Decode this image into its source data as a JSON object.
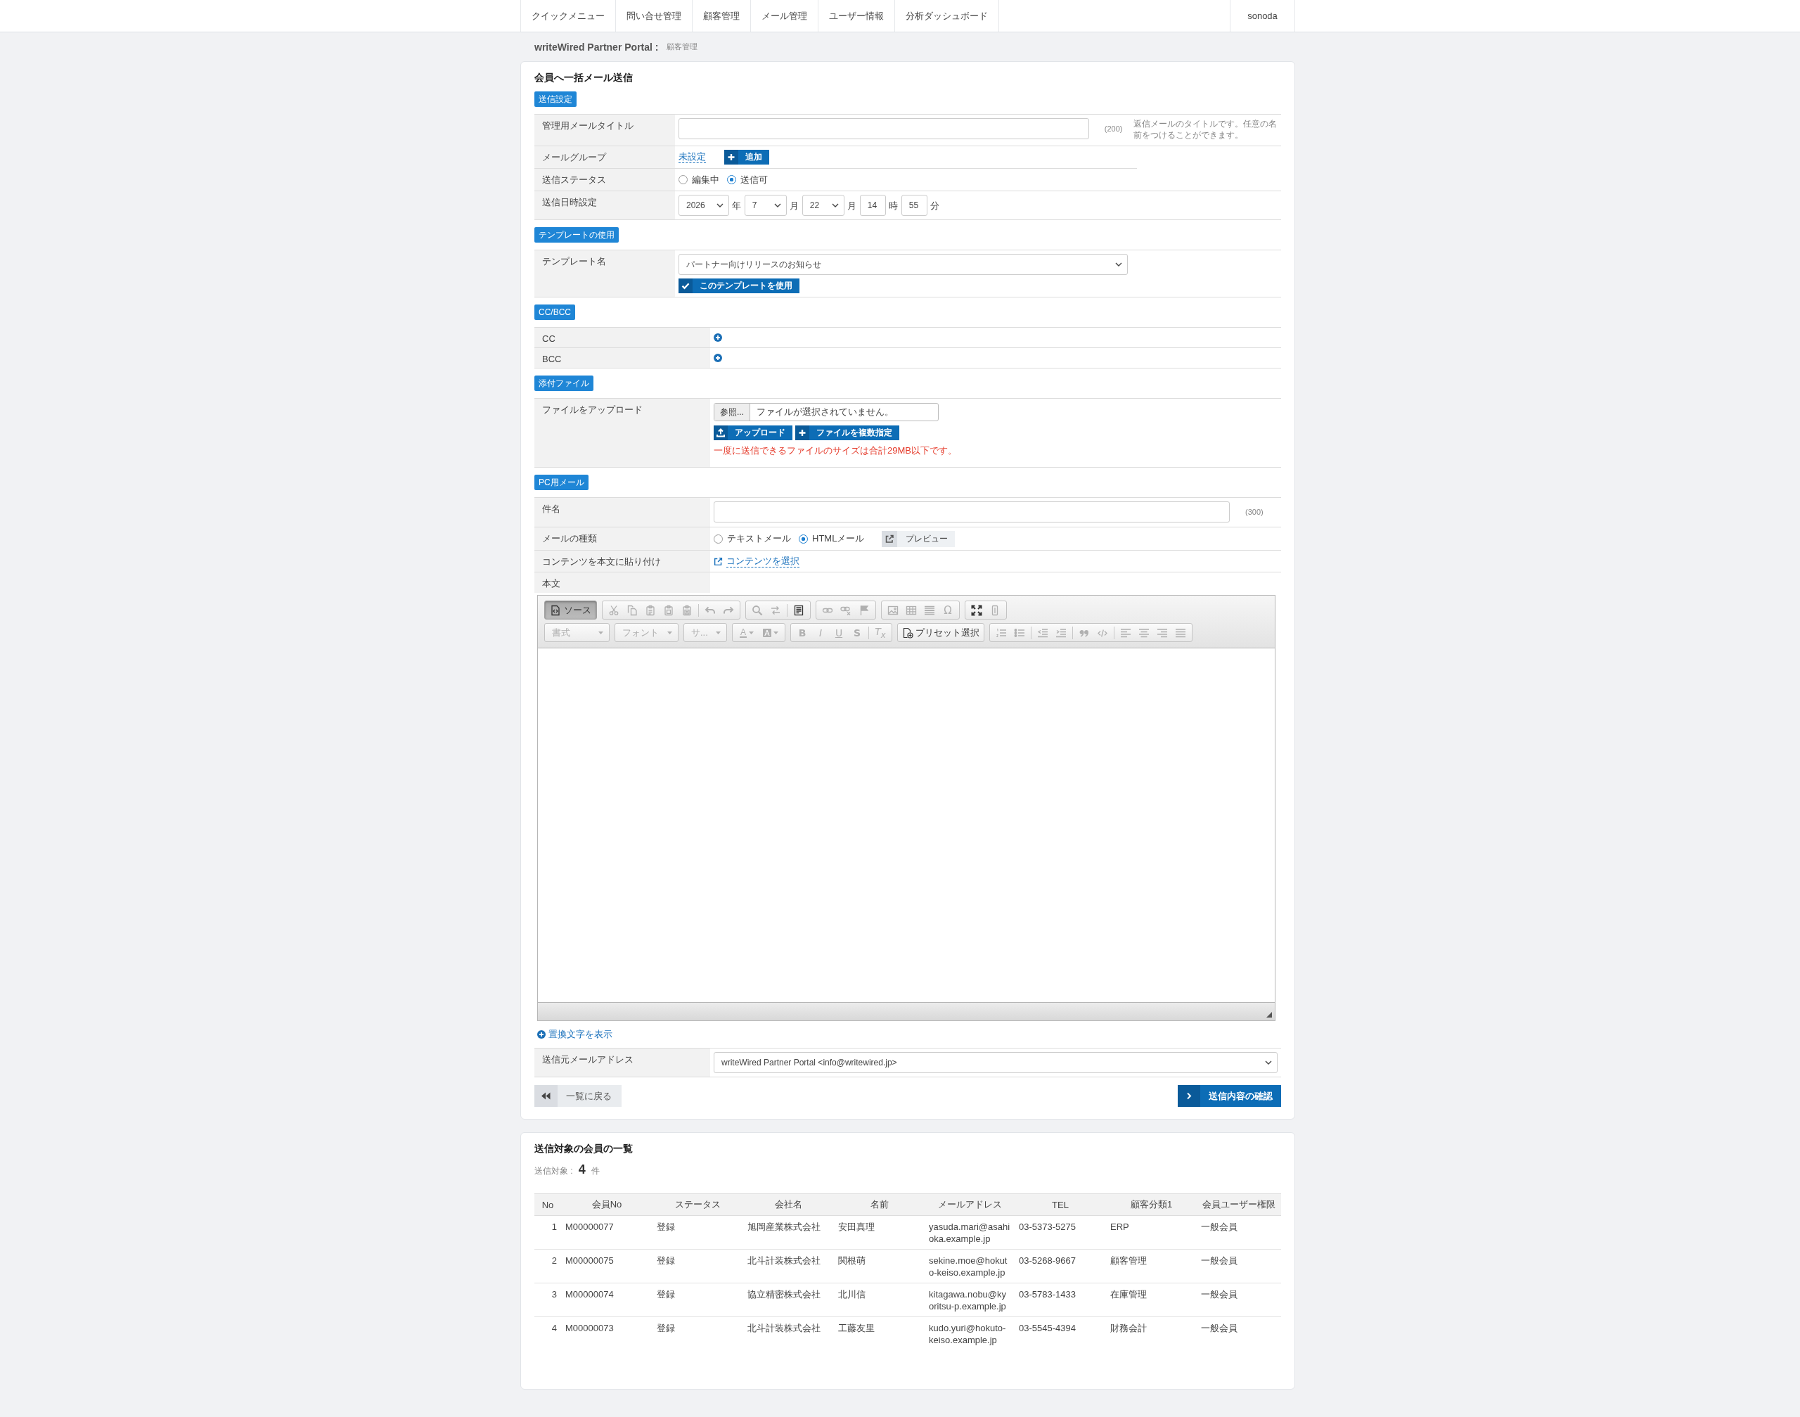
{
  "nav": {
    "items": [
      "クイックメニュー",
      "問い合せ管理",
      "顧客管理",
      "メール管理",
      "ユーザー情報",
      "分析ダッシュボード"
    ],
    "user": "sonoda"
  },
  "breadcrumb": {
    "site": "writeWired Partner Portal :",
    "page": "顧客管理"
  },
  "mail_form": {
    "title": "会員へ一括メール送信",
    "send_settings": {
      "badge": "送信設定",
      "admin_title": {
        "label": "管理用メールタイトル",
        "counter": "(200)",
        "help": "返信メールのタイトルです。任意の名前をつけることができます。"
      },
      "mail_group": {
        "label": "メールグループ",
        "value": "未設定",
        "button": "追加"
      },
      "status": {
        "label": "送信ステータス",
        "options": [
          {
            "label": "編集中",
            "selected": false
          },
          {
            "label": "送信可",
            "selected": true
          }
        ]
      },
      "schedule": {
        "label": "送信日時設定",
        "parts": [
          {
            "kind": "select",
            "value": "2026"
          },
          {
            "kind": "unit",
            "text": "年"
          },
          {
            "kind": "select",
            "value": "7"
          },
          {
            "kind": "unit",
            "text": "月"
          },
          {
            "kind": "select",
            "value": "22"
          },
          {
            "kind": "unit",
            "text": "月"
          },
          {
            "kind": "input",
            "value": "14"
          },
          {
            "kind": "unit",
            "text": "時"
          },
          {
            "kind": "input",
            "value": "55"
          },
          {
            "kind": "unit",
            "text": "分"
          }
        ]
      }
    },
    "template": {
      "badge": "テンプレートの使用",
      "label": "テンプレート名",
      "value": "パートナー向けリリースのお知らせ",
      "button": "このテンプレートを使用"
    },
    "cc_bcc": {
      "badge": "CC/BCC",
      "rows": [
        "CC",
        "BCC"
      ]
    },
    "attachments": {
      "badge": "添付ファイル",
      "label": "ファイルをアップロード",
      "browse_button": "参照...",
      "file_status": "ファイルが選択されていません。",
      "upload_button": "アップロード",
      "multi_button": "ファイルを複数指定",
      "note": "一度に送信できるファイルのサイズは合計29MB以下です。"
    },
    "pc_mail": {
      "badge": "PC用メール",
      "subject": {
        "label": "件名",
        "counter": "(300)"
      },
      "mail_type": {
        "label": "メールの種類",
        "options": [
          {
            "label": "テキストメール",
            "selected": false
          },
          {
            "label": "HTMLメール",
            "selected": true
          }
        ],
        "preview_button": "プレビュー"
      },
      "paste_contents": {
        "label": "コンテンツを本文に貼り付け",
        "link": "コンテンツを選択"
      },
      "body_label": "本文"
    },
    "editor": {
      "toolbar": [
        [
          [
            {
              "kind": "source",
              "label": "ソース",
              "on": true
            }
          ],
          [
            {
              "kind": "cut",
              "disabled": true
            },
            {
              "kind": "copy",
              "disabled": true
            },
            {
              "kind": "paste",
              "disabled": true
            },
            {
              "kind": "paste-text",
              "disabled": true
            },
            {
              "kind": "paste-word",
              "disabled": true
            },
            {
              "kind": "separator"
            },
            {
              "kind": "undo",
              "disabled": true
            },
            {
              "kind": "redo",
              "disabled": true
            }
          ],
          [
            {
              "kind": "find",
              "disabled": true
            },
            {
              "kind": "replace",
              "disabled": true
            },
            {
              "kind": "separator"
            },
            {
              "kind": "template",
              "disabled": false
            }
          ],
          [
            {
              "kind": "link",
              "disabled": true
            },
            {
              "kind": "unlink",
              "disabled": true
            },
            {
              "kind": "anchor",
              "disabled": true
            }
          ],
          [
            {
              "kind": "image",
              "disabled": true
            },
            {
              "kind": "table",
              "disabled": true
            },
            {
              "kind": "rule",
              "disabled": true
            },
            {
              "kind": "symbol",
              "label": "Ω",
              "disabled": true
            }
          ],
          [
            {
              "kind": "maximize",
              "disabled": false
            },
            {
              "kind": "blocks",
              "disabled": true
            }
          ]
        ],
        [
          [
            {
              "kind": "combo",
              "label": "書式",
              "disabled": true
            }
          ],
          [
            {
              "kind": "combo",
              "label": "フォント",
              "disabled": true
            }
          ],
          [
            {
              "kind": "combo",
              "label": "サ...",
              "disabled": true
            }
          ],
          [
            {
              "kind": "text-color",
              "label": "A",
              "disabled": true
            },
            {
              "kind": "bg-color",
              "label": "A",
              "disabled": true
            }
          ],
          [
            {
              "kind": "bold",
              "label": "B",
              "disabled": true
            },
            {
              "kind": "italic",
              "label": "I",
              "disabled": true
            },
            {
              "kind": "underline",
              "label": "U",
              "disabled": true
            },
            {
              "kind": "strike",
              "label": "S",
              "disabled": true
            },
            {
              "kind": "separator"
            },
            {
              "kind": "clear",
              "label": "T$_{x}$",
              "disabled": true
            }
          ],
          [
            {
              "kind": "preset",
              "label": "プリセット選択",
              "disabled": false
            }
          ],
          [
            {
              "kind": "numbered",
              "disabled": true
            },
            {
              "kind": "bulleted",
              "disabled": true
            },
            {
              "kind": "separator"
            },
            {
              "kind": "outdent",
              "disabled": true
            },
            {
              "kind": "indent",
              "disabled": true
            },
            {
              "kind": "separator"
            },
            {
              "kind": "quote",
              "disabled": true
            },
            {
              "kind": "div",
              "disabled": true
            },
            {
              "kind": "separator"
            },
            {
              "kind": "align-left",
              "disabled": true
            },
            {
              "kind": "align-center",
              "disabled": true
            },
            {
              "kind": "align-right",
              "disabled": true
            },
            {
              "kind": "justify",
              "disabled": true
            }
          ]
        ]
      ]
    },
    "placeholders_link": "置換文字を表示",
    "sender": {
      "label": "送信元メールアドレス",
      "value": "writeWired Partner Portal <info@writewired.jp>"
    },
    "back_button": "一覧に戻る",
    "confirm_button": "送信内容の確認"
  },
  "recipients": {
    "title": "送信対象の会員の一覧",
    "count_label": "送信対象 :",
    "count": "4",
    "count_unit": "件",
    "columns": [
      "No",
      "会員No",
      "ステータス",
      "会社名",
      "名前",
      "メールアドレス",
      "TEL",
      "顧客分類1",
      "会員ユーザー権限"
    ],
    "rows": [
      [
        "1",
        "M00000077",
        "登録",
        "旭岡産業株式会社",
        "安田真理",
        "yasuda.mari@asahioka.example.jp",
        "03-5373-5275",
        "ERP",
        "一般会員"
      ],
      [
        "2",
        "M00000075",
        "登録",
        "北斗計装株式会社",
        "関根萌",
        "sekine.moe@hokuto-keiso.example.jp",
        "03-5268-9667",
        "顧客管理",
        "一般会員"
      ],
      [
        "3",
        "M00000074",
        "登録",
        "協立精密株式会社",
        "北川信",
        "kitagawa.nobu@kyoritsu-p.example.jp",
        "03-5783-1433",
        "在庫管理",
        "一般会員"
      ],
      [
        "4",
        "M00000073",
        "登録",
        "北斗計装株式会社",
        "工藤友里",
        "kudo.yuri@hokuto-keiso.example.jp",
        "03-5545-4394",
        "財務会計",
        "一般会員"
      ]
    ]
  }
}
